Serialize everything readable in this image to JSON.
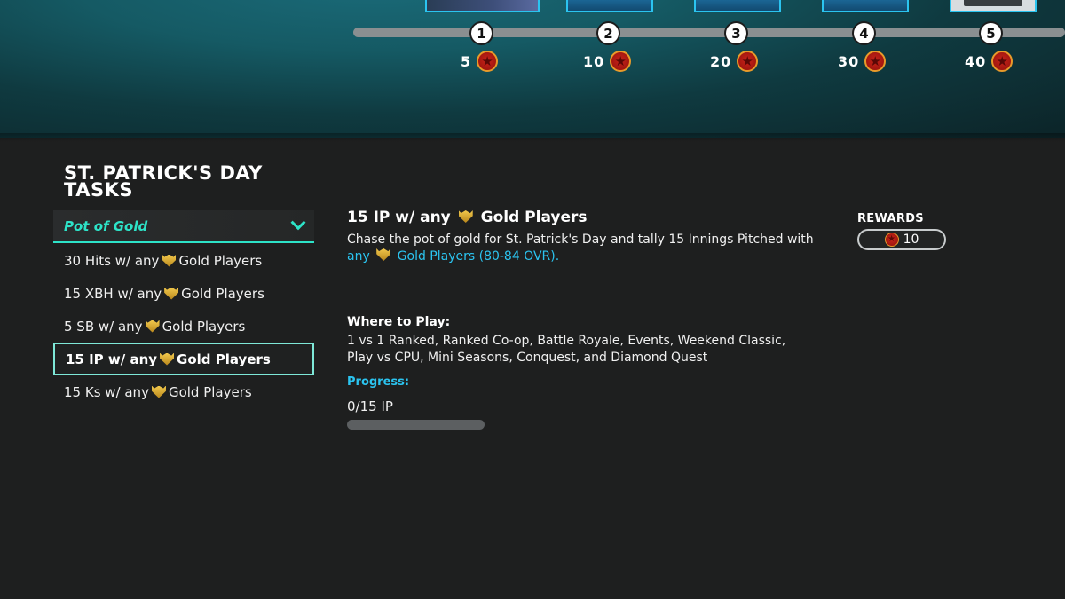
{
  "track": {
    "nodes": [
      {
        "number": "1",
        "reward": "5"
      },
      {
        "number": "2",
        "reward": "10"
      },
      {
        "number": "3",
        "reward": "20"
      },
      {
        "number": "4",
        "reward": "30"
      },
      {
        "number": "5",
        "reward": "40"
      }
    ],
    "reward_icon": "star-coin-icon"
  },
  "page": {
    "title": "ST. PATRICK'S DAY TASKS"
  },
  "task_group": {
    "selected_label": "Pot of Gold",
    "icon": "chevron-down-icon"
  },
  "tasks": [
    {
      "pre": "30 Hits w/ any",
      "post": "Gold Players",
      "icon": "gold-shield-icon",
      "selected": false
    },
    {
      "pre": "15 XBH w/ any",
      "post": "Gold Players",
      "icon": "gold-shield-icon",
      "selected": false
    },
    {
      "pre": "5 SB w/ any",
      "post": "Gold Players",
      "icon": "gold-shield-icon",
      "selected": false
    },
    {
      "pre": "15 IP w/ any",
      "post": "Gold Players",
      "icon": "gold-shield-icon",
      "selected": true
    },
    {
      "pre": "15 Ks w/ any",
      "post": "Gold Players",
      "icon": "gold-shield-icon",
      "selected": false
    }
  ],
  "detail": {
    "title_pre": "15 IP w/ any",
    "title_post": "Gold Players",
    "desc_main": "Chase the pot of gold for  St. Patrick's Day and tally 15 Innings Pitched with",
    "desc_hl_pre": "any",
    "desc_hl_post": "Gold Players (80-84 OVR).",
    "where_heading": "Where to Play:",
    "where_text": "1 vs 1 Ranked, Ranked Co-op, Battle Royale, Events, Weekend Classic, Play vs CPU, Mini Seasons, Conquest, and Diamond Quest",
    "progress_heading": "Progress:",
    "progress_text": "0/15 IP",
    "progress_fraction": 0
  },
  "rewards": {
    "heading": "REWARDS",
    "value": "10",
    "icon": "star-coin-icon"
  },
  "colors": {
    "accent_teal": "#2de3c8",
    "accent_blue": "#2bc4f0",
    "gold": "#f2c94c",
    "background": "#1e1f1f"
  }
}
